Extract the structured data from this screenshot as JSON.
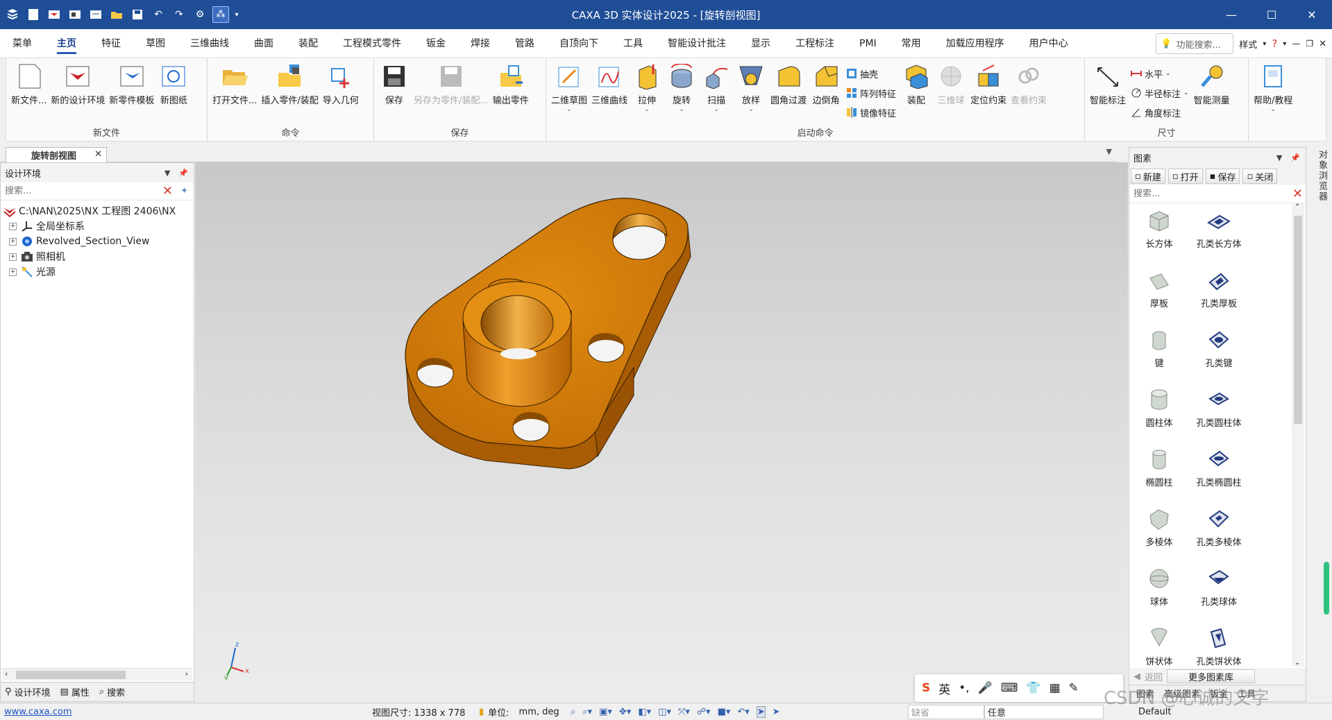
{
  "window": {
    "title": "CAXA 3D 实体设计2025 - [旋转剖视图]"
  },
  "menubar": {
    "items": [
      "菜单",
      "主页",
      "特征",
      "草图",
      "三维曲线",
      "曲面",
      "装配",
      "工程模式零件",
      "钣金",
      "焊接",
      "管路",
      "自顶向下",
      "工具",
      "智能设计批注",
      "显示",
      "工程标注",
      "PMI",
      "常用",
      "加载应用程序",
      "用户中心"
    ],
    "active": "主页",
    "search_placeholder": "功能搜索...",
    "style_label": "样式"
  },
  "ribbon": {
    "groups": [
      {
        "label": "新文件",
        "buttons": [
          "新文件...",
          "新的设计环境",
          "新零件模板",
          "新图纸"
        ]
      },
      {
        "label": "命令",
        "buttons": [
          "打开文件...",
          "插入零件/装配",
          "导入几何"
        ]
      },
      {
        "label": "保存",
        "buttons": [
          "保存",
          "另存为零件/装配...",
          "输出零件"
        ]
      },
      {
        "label": "启动命令",
        "buttons": [
          "二维草图",
          "三维曲线",
          "拉伸",
          "旋转",
          "扫描",
          "放样",
          "圆角过渡",
          "边倒角"
        ],
        "small": [
          "抽壳",
          "阵列特征",
          "镜像特征"
        ],
        "buttons2": [
          "装配",
          "三维球",
          "定位约束",
          "查看约束"
        ]
      },
      {
        "label": "尺寸",
        "buttons": [
          "智能标注"
        ],
        "small": [
          "水平",
          "半径标注",
          "角度标注"
        ],
        "buttons2": [
          "智能测量"
        ]
      },
      {
        "label": "",
        "buttons": [
          "帮助/教程"
        ]
      }
    ]
  },
  "doc_tab": {
    "label": "旋转剖视图"
  },
  "left_panel": {
    "title": "设计环境",
    "search_placeholder": "搜索...",
    "tree": [
      {
        "label": "C:\\NAN\\2025\\NX 工程图 2406\\NX",
        "level": 0
      },
      {
        "label": "全局坐标系",
        "level": 1
      },
      {
        "label": "Revolved_Section_View",
        "level": 1
      },
      {
        "label": "照相机",
        "level": 1
      },
      {
        "label": "光源",
        "level": 1
      }
    ],
    "tabs": [
      "设计环境",
      "属性",
      "搜索"
    ]
  },
  "right_panel": {
    "title": "图素",
    "toolbar": [
      "新建",
      "打开",
      "保存",
      "关闭"
    ],
    "search_placeholder": "搜索...",
    "shapes": [
      [
        "长方体",
        "孔类长方体"
      ],
      [
        "厚板",
        "孔类厚板"
      ],
      [
        "键",
        "孔类键"
      ],
      [
        "圆柱体",
        "孔类圆柱体"
      ],
      [
        "椭圆柱",
        "孔类椭圆柱"
      ],
      [
        "多棱体",
        "孔类多棱体"
      ],
      [
        "球体",
        "孔类球体"
      ],
      [
        "饼状体",
        "孔类饼状体"
      ]
    ],
    "back_label": "返回",
    "more_label": "更多图素库",
    "tabs": [
      "图素",
      "高级图素",
      "钣金",
      "工具"
    ],
    "side_tab": "对象浏览器"
  },
  "ime": {
    "lang": "英"
  },
  "statusbar": {
    "site": "www.caxa.com",
    "view_size_label": "视图尺寸: 1338 x 778",
    "unit_label": "单位:",
    "unit_value": "mm, deg",
    "filter_placeholder": "缺省",
    "select_value": "任意",
    "render_value": "Default"
  },
  "watermark": "CSDN @心诚的文字",
  "triad": {
    "z": "z",
    "x": "x",
    "y": "y"
  }
}
